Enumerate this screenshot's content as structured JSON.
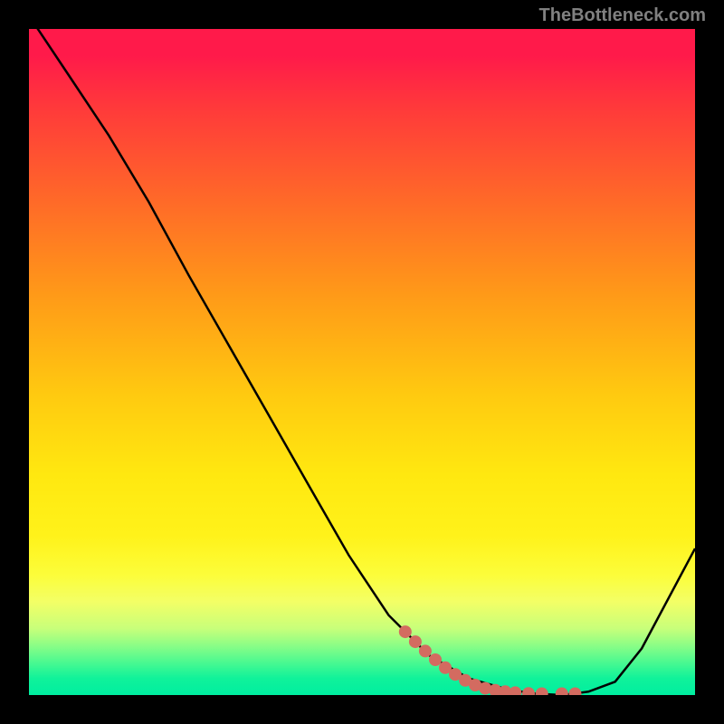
{
  "watermark": "TheBottleneck.com",
  "chart_data": {
    "type": "line",
    "title": "",
    "xlabel": "",
    "ylabel": "",
    "x": [
      0,
      6,
      12,
      18,
      24,
      30,
      36,
      42,
      48,
      54,
      60,
      66,
      72,
      76,
      80,
      84,
      88,
      92,
      100
    ],
    "series": [
      {
        "name": "curve",
        "color": "#000000",
        "values": [
          102,
          93,
          84,
          74,
          63,
          52.5,
          42,
          31.5,
          21,
          12,
          6,
          2.5,
          0.8,
          0.2,
          0,
          0.5,
          2,
          7,
          22
        ]
      },
      {
        "name": "highlight-dots",
        "color": "#d36b60",
        "x": [
          56.5,
          58,
          59.5,
          61,
          62.5,
          64,
          65.5,
          67,
          68.5,
          70,
          71.5,
          73,
          75,
          77,
          80,
          82
        ],
        "values": [
          9.5,
          8,
          6.6,
          5.3,
          4.1,
          3.1,
          2.2,
          1.5,
          1.0,
          0.7,
          0.5,
          0.35,
          0.25,
          0.2,
          0.2,
          0.2
        ]
      }
    ],
    "xlim": [
      0,
      100
    ],
    "ylim": [
      0,
      100
    ]
  }
}
